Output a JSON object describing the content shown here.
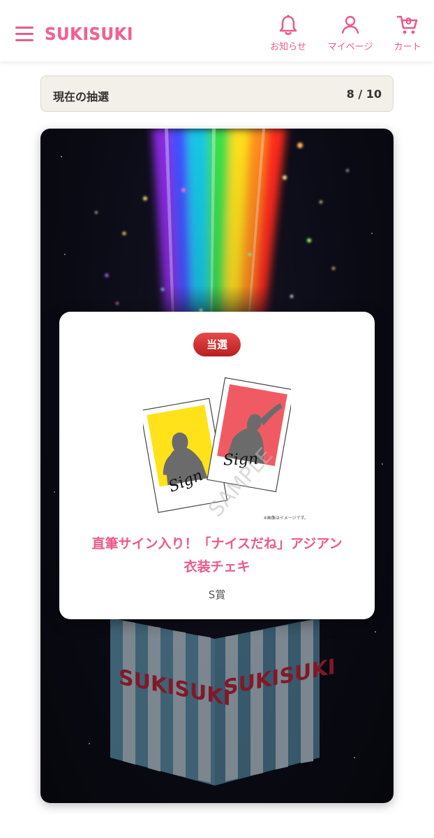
{
  "header": {
    "logo": "SUKISUKI",
    "nav": {
      "notifications_label": "お知らせ",
      "mypage_label": "マイページ",
      "cart_label": "カート",
      "cart_count": "0"
    }
  },
  "status": {
    "label": "現在の抽選",
    "count": "8 / 10"
  },
  "stage": {
    "box_text_left": "SUKISUKI",
    "box_text_right": "SUKISUKI"
  },
  "result": {
    "badge": "当選",
    "image_note": "※画像はイメージです。",
    "sample_watermark": "SAMPLE",
    "sign_text": "Sign",
    "title_line1": "直筆サイン入り！「ナイスだね」アジアン",
    "title_line2": "衣装チェキ",
    "rank": "S賞"
  },
  "colors": {
    "brand_pink": "#ec5a8a",
    "badge_red": "#c62828",
    "status_bg": "#f3f0ea"
  }
}
